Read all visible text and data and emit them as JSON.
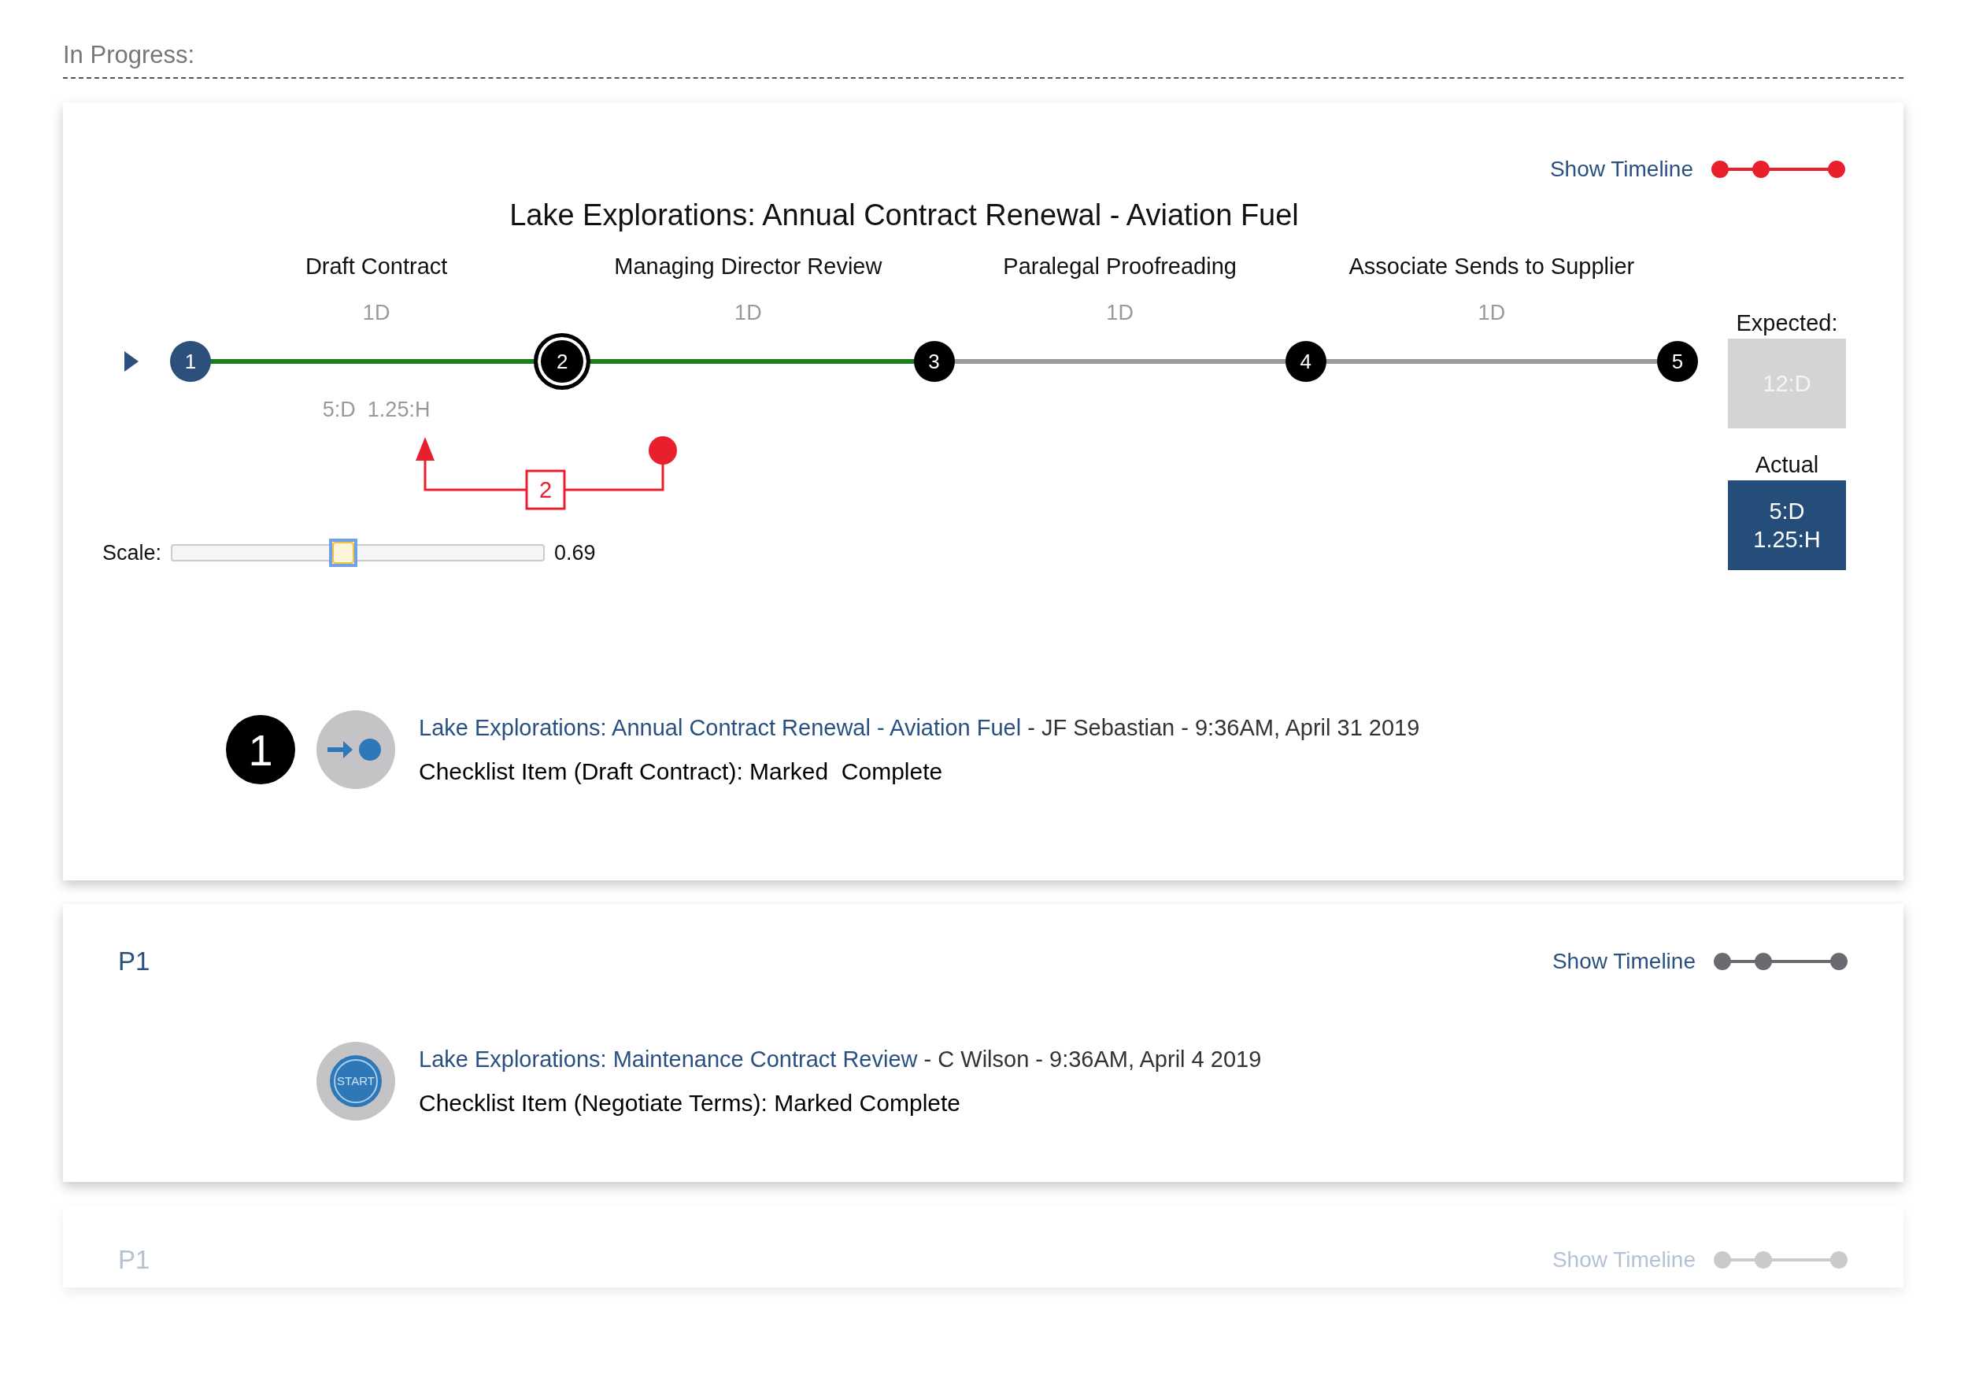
{
  "section_title": "In Progress:",
  "cards": [
    {
      "kind": "timeline",
      "faded": false,
      "show_timeline": {
        "label": "Show Timeline",
        "active": true
      },
      "title": "Lake Explorations: Annual Contract Renewal - Aviation Fuel",
      "steps": [
        {
          "label": "Draft Contract",
          "duration": "1D",
          "complete": true
        },
        {
          "label": "Managing Director Review",
          "duration": "1D",
          "complete": true
        },
        {
          "label": "Paralegal Proofreading",
          "duration": "1D",
          "complete": false
        },
        {
          "label": "Associate Sends to Supplier",
          "duration": "1D",
          "complete": false
        }
      ],
      "nodes": [
        {
          "number": "1",
          "done": true,
          "selected": false
        },
        {
          "number": "2",
          "done": false,
          "selected": true
        },
        {
          "number": "3",
          "done": false,
          "selected": false
        },
        {
          "number": "4",
          "done": false,
          "selected": false
        },
        {
          "number": "5",
          "done": false,
          "selected": false
        }
      ],
      "node_note": "5:D  1.25:H",
      "annotation": {
        "label": "2"
      },
      "scale": {
        "label": "Scale:",
        "level": 0.46,
        "reading": "0.69"
      },
      "expected": {
        "label": "Expected:",
        "value": "12:D"
      },
      "actual": {
        "label": "Actual",
        "lines": [
          "5:D",
          "1.25:H"
        ]
      },
      "activity": {
        "marker": "1",
        "kind": "arrow-dot",
        "link": "Lake Explorations: Annual Contract Renewal - Aviation Fuel",
        "meta": " - JF Sebastian - 9:36AM, April 31 2019",
        "detail": "Checklist Item (Draft Contract): Marked  Complete"
      }
    },
    {
      "kind": "summary",
      "faded": false,
      "heading": "P1",
      "show_timeline": {
        "label": "Show Timeline",
        "active": false
      },
      "activity": {
        "kind": "start",
        "icon_label": "START",
        "link": "Lake Explorations: Maintenance Contract Review",
        "meta": " - C Wilson - 9:36AM, April 4 2019",
        "detail": "Checklist Item (Negotiate Terms): Marked Complete"
      }
    },
    {
      "kind": "summary",
      "faded": true,
      "heading": "P1",
      "show_timeline": {
        "label": "Show Timeline",
        "active": false
      }
    }
  ]
}
